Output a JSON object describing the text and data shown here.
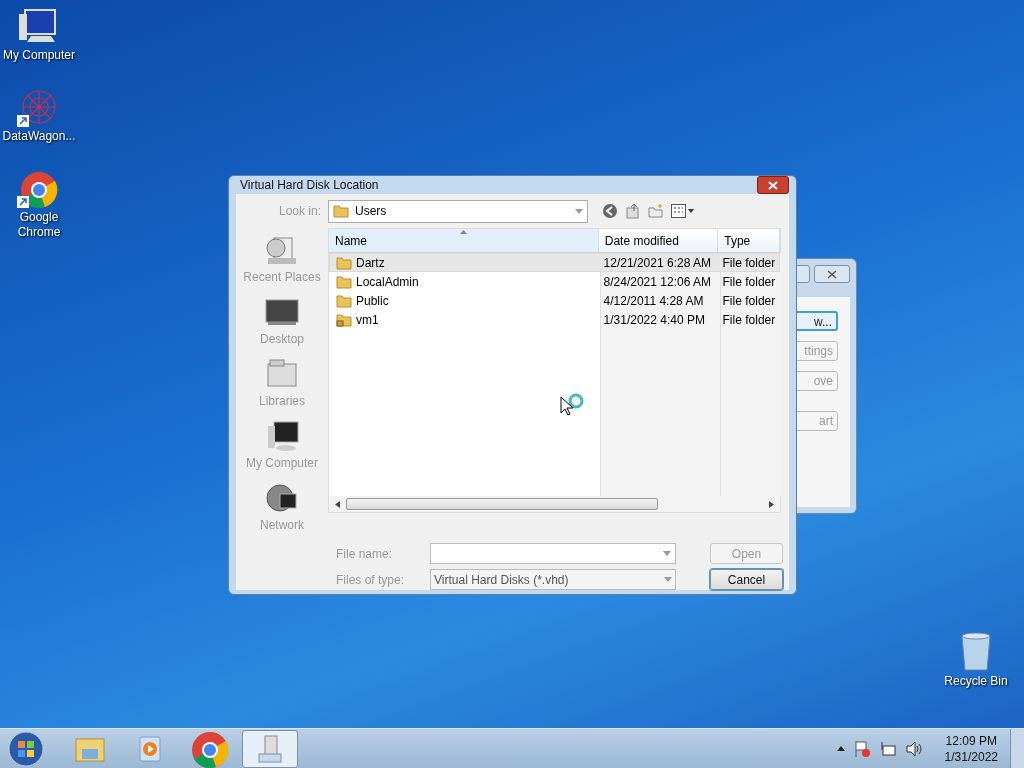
{
  "desktop_icons": [
    {
      "label": "My Computer",
      "kind": "computer",
      "shortcut": false
    },
    {
      "label": "DataWagon...",
      "kind": "app",
      "shortcut": true
    },
    {
      "label": "Google Chrome",
      "kind": "chrome",
      "shortcut": true
    }
  ],
  "recycle_bin": {
    "label": "Recycle Bin"
  },
  "background_window": {
    "buttons": [
      {
        "label": "w...",
        "default": true
      },
      {
        "label": "ttings",
        "default": false
      },
      {
        "label": "ove",
        "default": false
      },
      {
        "label": "art",
        "default": false
      }
    ]
  },
  "dialog": {
    "title": "Virtual Hard Disk Location",
    "look_in": {
      "label": "Look in:",
      "value": "Users"
    },
    "places": [
      {
        "label": "Recent Places",
        "kind": "recent"
      },
      {
        "label": "Desktop",
        "kind": "desktop"
      },
      {
        "label": "Libraries",
        "kind": "libraries"
      },
      {
        "label": "My Computer",
        "kind": "computer"
      },
      {
        "label": "Network",
        "kind": "network"
      }
    ],
    "columns": [
      {
        "label": "Name",
        "sorted": true
      },
      {
        "label": "Date modified",
        "sorted": false
      },
      {
        "label": "Type",
        "sorted": false
      }
    ],
    "rows": [
      {
        "name": "Dartz",
        "date": "12/21/2021 6:28 AM",
        "type": "File folder",
        "selected": true,
        "locked": false
      },
      {
        "name": "LocalAdmin",
        "date": "8/24/2021 12:06 AM",
        "type": "File folder",
        "selected": false,
        "locked": false
      },
      {
        "name": "Public",
        "date": "4/12/2011 4:28 AM",
        "type": "File folder",
        "selected": false,
        "locked": false
      },
      {
        "name": "vm1",
        "date": "1/31/2022 4:40 PM",
        "type": "File folder",
        "selected": false,
        "locked": true
      }
    ],
    "file_name": {
      "label": "File name:"
    },
    "files_of_type": {
      "label": "Files of type:",
      "value": "Virtual Hard Disks (*.vhd)"
    },
    "buttons": [
      {
        "label": "Open",
        "disabled": true,
        "default": false
      },
      {
        "label": "Cancel",
        "disabled": false,
        "default": true
      }
    ]
  },
  "taskbar": {
    "items": [
      {
        "kind": "explorer",
        "active": false
      },
      {
        "kind": "media",
        "active": false
      },
      {
        "kind": "chrome",
        "active": false
      },
      {
        "kind": "vm",
        "active": true
      }
    ],
    "time": "12:09 PM",
    "date": "1/31/2022"
  }
}
